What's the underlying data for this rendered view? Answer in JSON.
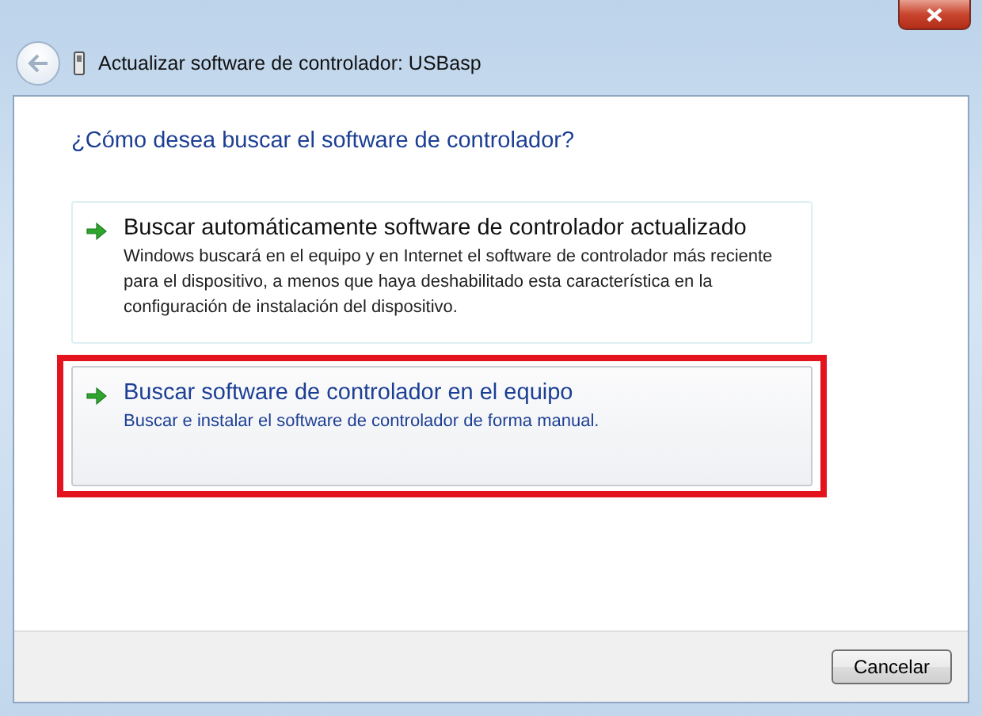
{
  "window": {
    "title": "Actualizar software de controlador: USBasp"
  },
  "heading": "¿Cómo desea buscar el software de controlador?",
  "options": [
    {
      "title": "Buscar automáticamente software de controlador actualizado",
      "description": "Windows buscará en el equipo y en Internet el software de controlador más reciente para el dispositivo, a menos que haya deshabilitado esta característica en la configuración de instalación del dispositivo.",
      "selected": false,
      "highlighted": false
    },
    {
      "title": "Buscar software de controlador en el equipo",
      "description": "Buscar e instalar el software de controlador de forma manual.",
      "selected": true,
      "highlighted": true
    }
  ],
  "buttons": [
    "Cancelar"
  ]
}
